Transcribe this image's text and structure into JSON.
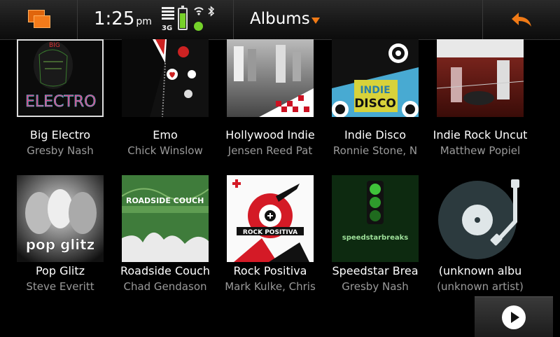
{
  "status": {
    "time": "1:25",
    "ampm": "pm",
    "network": "3G"
  },
  "header": {
    "title": "Albums",
    "accent": "#f07a16"
  },
  "icons": {
    "task_switcher": "task-switcher-icon",
    "back": "back-arrow-icon",
    "play": "play-icon"
  },
  "albums": [
    {
      "title": "Big Electro",
      "artist": "Gresby Nash"
    },
    {
      "title": "Emo",
      "artist": "Chick Winslow"
    },
    {
      "title": "Hollywood Indie",
      "artist": "Jensen Reed Pat"
    },
    {
      "title": "Indie Disco",
      "artist": "Ronnie Stone, N"
    },
    {
      "title": "Indie Rock Uncut",
      "artist": "Matthew Popiel"
    },
    {
      "title": "Pop Glitz",
      "artist": "Steve Everitt"
    },
    {
      "title": "Roadside Couch",
      "artist": "Chad Gendason"
    },
    {
      "title": "Rock Positiva",
      "artist": "Mark Kulke, Chris"
    },
    {
      "title": "Speedstar Brea",
      "artist": "Gresby Nash"
    },
    {
      "title": "(unknown albu",
      "artist": "(unknown artist)"
    }
  ],
  "covers": {
    "big_electro": [
      "BIG",
      "ELECTRO"
    ],
    "indie_disco": [
      "INDIE",
      "DISCO"
    ],
    "pop_glitz": "pop glitz",
    "roadside_couch": "ROADSIDE COUCH",
    "rock_positiva": "ROCK POSITIVA",
    "speedstar": "speedstarbreaks"
  }
}
